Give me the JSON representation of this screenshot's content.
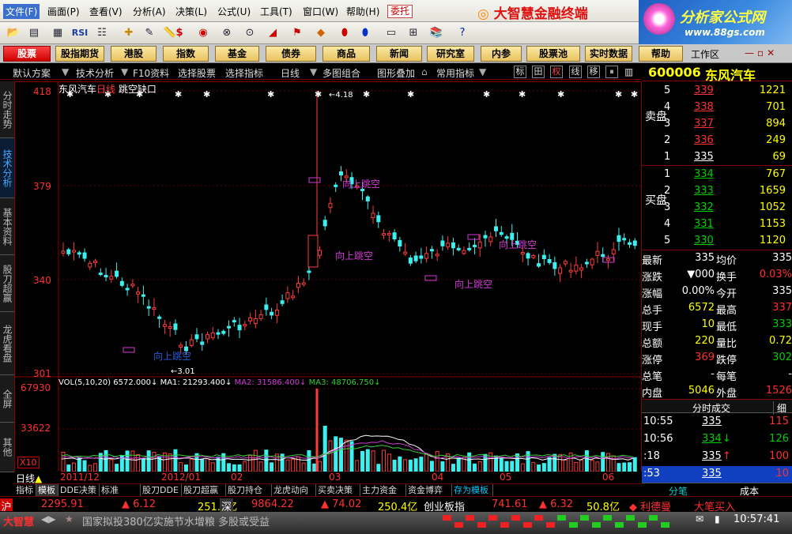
{
  "menu": {
    "items": [
      "文件(F)",
      "画面(P)",
      "查看(V)",
      "分析(A)",
      "决策(L)",
      "公式(U)",
      "工具(T)",
      "窗口(W)",
      "帮助(H)"
    ],
    "weituo": "委托",
    "brand": "大智慧金融终端"
  },
  "logo": {
    "line1": "分析家公式网",
    "line2": "www.88gs.com"
  },
  "toolbar": {
    "icons": [
      "open-icon",
      "chart-icon",
      "table-icon",
      "rsi-icon",
      "list-icon",
      "crosshair-icon",
      "pencil-icon",
      "ruler-icon",
      "dollar-icon",
      "goggles-icon",
      "binocular-icon",
      "megaphone-icon",
      "flag-icon",
      "diamond-icon",
      "red-badge-icon",
      "blue-badge-icon",
      "notebook-icon",
      "grid-icon",
      "books-icon",
      "help-icon"
    ],
    "rsi_label": "RSI"
  },
  "nav": {
    "items": [
      "股票",
      "股指期货",
      "港股",
      "指数",
      "基金",
      "债券",
      "商品",
      "新闻",
      "研究室",
      "内参",
      "股票池",
      "实时数据",
      "帮助"
    ],
    "workspace": "工作区"
  },
  "toolbar2": {
    "items": [
      "默认方案",
      "技术分析",
      "F10资料",
      "选择股票",
      "选择指标",
      "日线",
      "多图组合",
      "图形叠加",
      "常用指标"
    ],
    "right": [
      "标",
      "田",
      "权",
      "线",
      "移",
      "⏸"
    ]
  },
  "stock": {
    "code": "600006",
    "name": "东风汽车"
  },
  "sidetabs": [
    "分时走势",
    "技术分析",
    "基本资料",
    "股刀超赢",
    "龙虎看盘",
    "全屏",
    "其他"
  ],
  "chart": {
    "title": "东风汽车",
    "period": "日线",
    "indicator": "跳空缺口",
    "price_ticks": [
      "418",
      "379",
      "340",
      "301"
    ],
    "high_label": "4.18",
    "low_label": "3.01",
    "gap_labels": [
      "向上跳空",
      "向上跳空",
      "向上跳空",
      "向上跳空",
      "向上跳空"
    ],
    "vol_label": "VOL(5,10,20)",
    "vol_value": "6572.000↓",
    "ma1": "MA1: 21293.400↓",
    "ma2": "MA2: 31586.400↓",
    "ma3": "MA3: 48706.750↓",
    "vol_ticks": [
      "67930",
      "33622"
    ],
    "vol_unit": "X10",
    "period_label": "日线",
    "date_ticks": [
      "2011/12",
      "2012/01",
      "02",
      "03",
      "04",
      "05",
      "06"
    ]
  },
  "quote": {
    "sell_label": "卖盘",
    "buy_label": "买盘",
    "asks": [
      {
        "lvl": "5",
        "p": "339",
        "v": "1221"
      },
      {
        "lvl": "4",
        "p": "338",
        "v": "701"
      },
      {
        "lvl": "3",
        "p": "337",
        "v": "894"
      },
      {
        "lvl": "2",
        "p": "336",
        "v": "249"
      },
      {
        "lvl": "1",
        "p": "335",
        "v": "69"
      }
    ],
    "bids": [
      {
        "lvl": "1",
        "p": "334",
        "v": "767"
      },
      {
        "lvl": "2",
        "p": "333",
        "v": "1659"
      },
      {
        "lvl": "3",
        "p": "332",
        "v": "1052"
      },
      {
        "lvl": "4",
        "p": "331",
        "v": "1153"
      },
      {
        "lvl": "5",
        "p": "330",
        "v": "1120"
      }
    ],
    "stats": [
      {
        "k1": "最新",
        "v1": "335",
        "k2": "均价",
        "v2": "335"
      },
      {
        "k1": "涨跌",
        "v1": "▼000",
        "k2": "换手",
        "v2": "0.03%"
      },
      {
        "k1": "涨幅",
        "v1": "0.00%",
        "k2": "今开",
        "v2": "335"
      },
      {
        "k1": "总手",
        "v1": "6572",
        "k2": "最高",
        "v2": "337"
      },
      {
        "k1": "现手",
        "v1": "10",
        "k2": "最低",
        "v2": "333"
      },
      {
        "k1": "总额",
        "v1": "220",
        "k2": "量比",
        "v2": "0.72"
      },
      {
        "k1": "涨停",
        "v1": "369",
        "k2": "跌停",
        "v2": "302"
      },
      {
        "k1": "总笔",
        "v1": "-",
        "k2": "每笔",
        "v2": "-"
      },
      {
        "k1": "内盘",
        "v1": "5046",
        "k2": "外盘",
        "v2": "1526"
      }
    ]
  },
  "trades": {
    "title": "分时成交",
    "tab": "细",
    "rows": [
      {
        "t": "10:55",
        "p": "335",
        "a": "",
        "v": "115"
      },
      {
        "t": "10:56",
        "p": "334",
        "a": "↓",
        "v": "126"
      },
      {
        "t": ":18",
        "p": "335",
        "a": "↑",
        "v": "100"
      },
      {
        "t": ":53",
        "p": "335",
        "a": "",
        "v": "10"
      }
    ],
    "tab_left": "分笔",
    "tab_right": "成本"
  },
  "bottomtabs": [
    "指标",
    "模板",
    "DDE决策",
    "标准",
    "股刀DDE",
    "股刀超赢",
    "股刀持仓",
    "龙虎动向",
    "买卖决策",
    "主力资金",
    "资金博弈",
    "存为模板"
  ],
  "index": {
    "sh_label": "沪",
    "sh_val": "2295.91",
    "sh_chg": "▲ 6.12",
    "sh_amt": "251.8亿",
    "sz_label": "深",
    "sz_val": "9864.22",
    "sz_chg": "▲ 74.02",
    "sz_amt": "250.4亿",
    "cy_label": "创业板指",
    "cy_val": "741.61",
    "cy_chg": "▲ 6.32",
    "cy_amt": "50.8亿",
    "alert": "◆ 利德曼",
    "alert2": "大笔买入"
  },
  "status": {
    "logo": "大智慧",
    "news": "国家拟投380亿实施节水增粮 多股或受益",
    "time": "10:57:41"
  }
}
